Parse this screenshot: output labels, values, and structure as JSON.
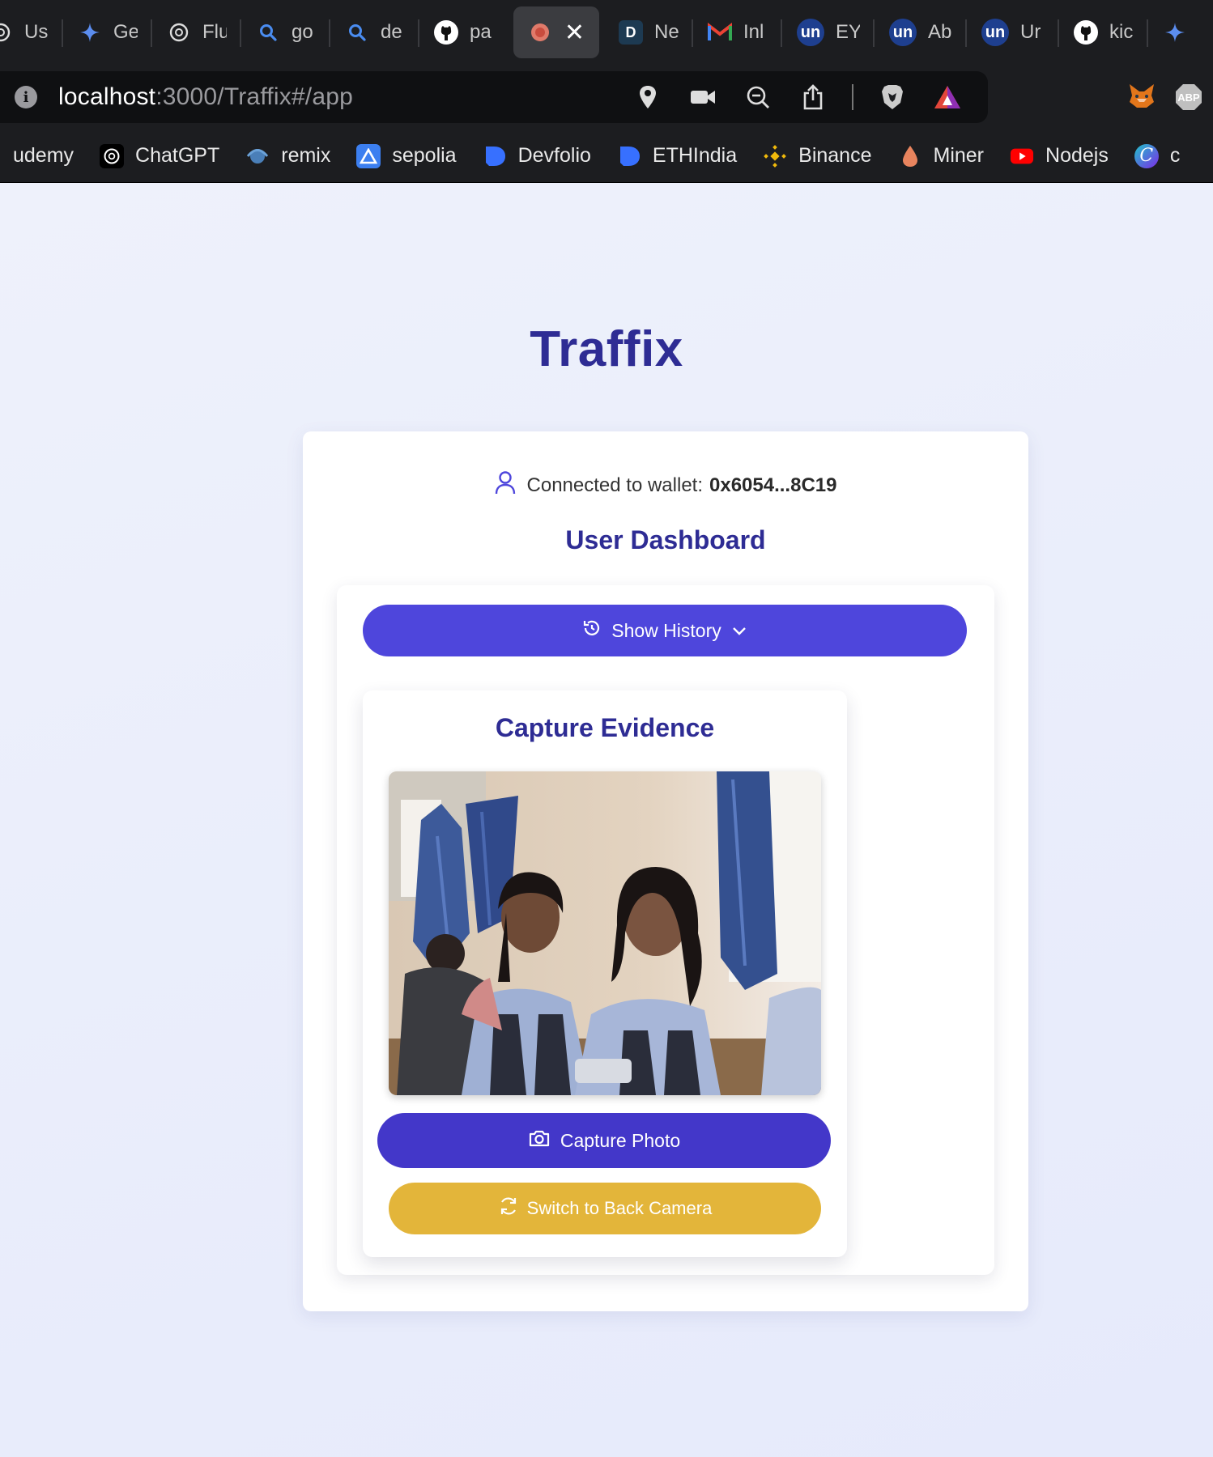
{
  "browser": {
    "tabs": [
      {
        "label": "Us",
        "icon": "openai-icon"
      },
      {
        "label": "Ge",
        "icon": "gemini-icon"
      },
      {
        "label": "Flu",
        "icon": "openai-icon"
      },
      {
        "label": "go",
        "icon": "search-icon"
      },
      {
        "label": "de",
        "icon": "search-icon"
      },
      {
        "label": "pa",
        "icon": "github-icon"
      },
      {
        "label": "",
        "icon": "record-icon",
        "active": true
      },
      {
        "label": "Ne",
        "icon": "d-icon"
      },
      {
        "label": "Inl",
        "icon": "gmail-icon"
      },
      {
        "label": "EY",
        "icon": "unstop-icon"
      },
      {
        "label": "Ab",
        "icon": "unstop-icon"
      },
      {
        "label": "Ur",
        "icon": "unstop-icon"
      },
      {
        "label": "kic",
        "icon": "github-icon"
      }
    ],
    "url_host": "localhost",
    "url_path": ":3000/Traffix#/app",
    "bookmarks": [
      {
        "label": "udemy",
        "icon": ""
      },
      {
        "label": "ChatGPT",
        "icon": "openai-icon"
      },
      {
        "label": "remix",
        "icon": "remix-icon"
      },
      {
        "label": "sepolia",
        "icon": "sepolia-icon"
      },
      {
        "label": "Devfolio",
        "icon": "devfolio-icon"
      },
      {
        "label": "ETHIndia",
        "icon": "devfolio-icon"
      },
      {
        "label": "Binance",
        "icon": "binance-icon"
      },
      {
        "label": "Miner",
        "icon": "drop-icon"
      },
      {
        "label": "Nodejs",
        "icon": "youtube-icon"
      },
      {
        "label": "c",
        "icon": "canva-icon"
      }
    ]
  },
  "app": {
    "title": "Traffix",
    "wallet_prefix": "Connected to wallet:",
    "wallet_address": "0x6054...8C19",
    "dashboard_title": "User Dashboard",
    "history_button": "Show History",
    "capture_title": "Capture Evidence",
    "capture_button": "Capture Photo",
    "switch_button": "Switch to Back Camera"
  },
  "colors": {
    "primary": "#4e46dc",
    "primary_dark": "#4337c9",
    "heading": "#2e2c94",
    "accent_yellow": "#e3b53a"
  }
}
